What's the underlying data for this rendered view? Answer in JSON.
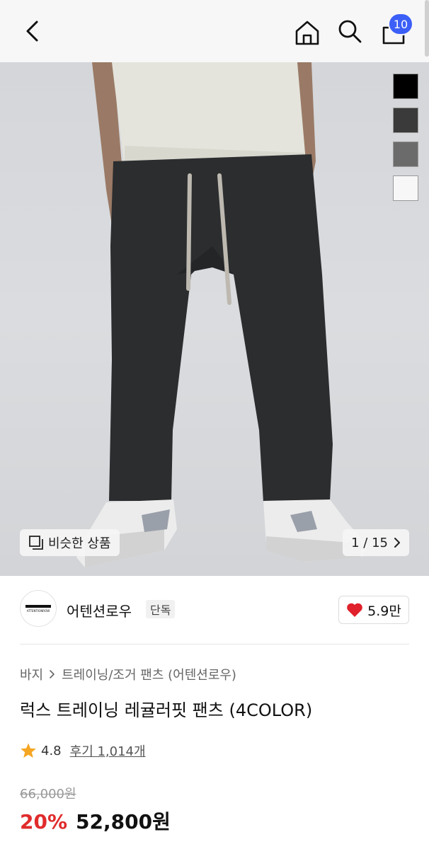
{
  "header": {
    "cart_count": "10"
  },
  "hero": {
    "swatch_colors": [
      "#000000",
      "#3a3a3a",
      "#6b6b6b",
      "#f7f7f7"
    ],
    "similar_label": "비슷한 상품",
    "counter": "1 / 15"
  },
  "brand": {
    "logo_text": "ATTENTIONROW",
    "name": "어텐션로우",
    "tag": "단독",
    "likes": "5.9만"
  },
  "breadcrumb": {
    "category": "바지",
    "subcategory": "트레이닝/조거 팬츠 (어텐션로우)"
  },
  "product": {
    "title": "럭스 트레이닝 레귤러핏 팬츠 (4COLOR)",
    "rating": "4.8",
    "reviews": "후기 1,014개",
    "original_price": "66,000원",
    "discount": "20%",
    "price": "52,800원"
  },
  "colors": {
    "accent_blue": "#3b5ff7",
    "discount_red": "#e02b2b",
    "heart_red": "#e0202a",
    "star_orange": "#f5a623"
  }
}
